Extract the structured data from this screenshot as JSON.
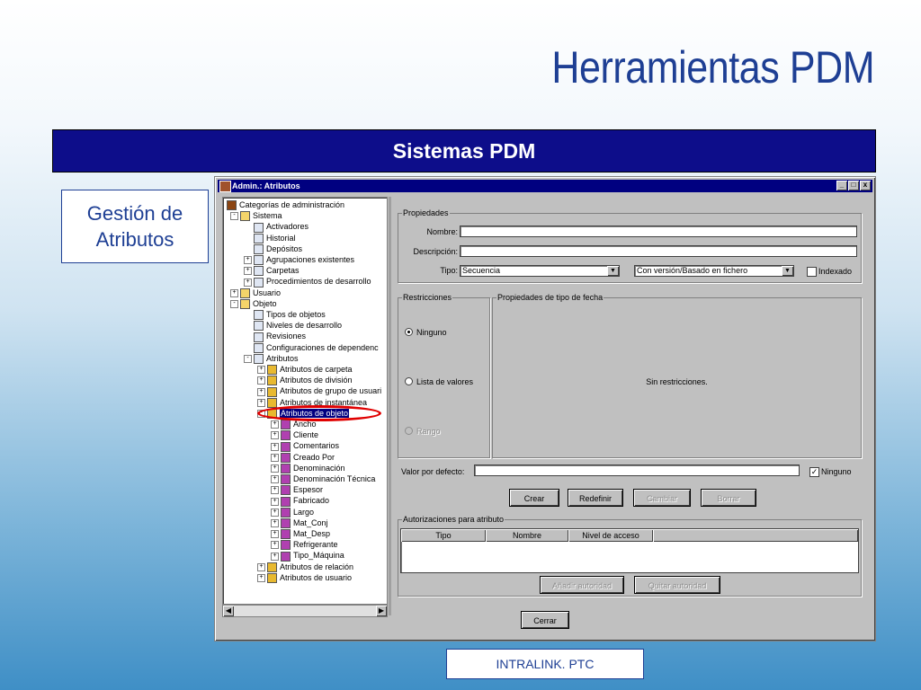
{
  "slide": {
    "title": "Herramientas PDM",
    "banner": "Sistemas PDM",
    "side_label": "Gestión de Atributos",
    "footer": "INTRALINK. PTC"
  },
  "window": {
    "title": "Admin.: Atributos",
    "buttons": [
      "_",
      "□",
      "x"
    ]
  },
  "tree": [
    {
      "label": "Categorías de administración",
      "icon": "root-icon"
    },
    {
      "label": "Sistema",
      "icon": "folder-icon",
      "exp": "-"
    },
    {
      "label": "Activadores",
      "icon": "table-icon"
    },
    {
      "label": "Historial",
      "icon": "table-icon"
    },
    {
      "label": "Depósitos",
      "icon": "table-icon"
    },
    {
      "label": "Agrupaciones existentes",
      "icon": "table-icon",
      "exp": "+"
    },
    {
      "label": "Carpetas",
      "icon": "table-icon",
      "exp": "+"
    },
    {
      "label": "Procedimientos de desarrollo",
      "icon": "table-icon",
      "exp": "+"
    },
    {
      "label": "Usuario",
      "icon": "folder-icon",
      "exp": "+"
    },
    {
      "label": "Objeto",
      "icon": "folder-icon",
      "exp": "-"
    },
    {
      "label": "Tipos de objetos",
      "icon": "table-icon"
    },
    {
      "label": "Niveles de desarrollo",
      "icon": "table-icon"
    },
    {
      "label": "Revisiones",
      "icon": "table-icon"
    },
    {
      "label": "Configuraciones de dependenc",
      "icon": "table-icon"
    },
    {
      "label": "Atributos",
      "icon": "table-icon",
      "exp": "-"
    },
    {
      "label": "Atributos de carpeta",
      "icon": "attr-icon",
      "exp": "+"
    },
    {
      "label": "Atributos de división",
      "icon": "attr-icon",
      "exp": "+"
    },
    {
      "label": "Atributos de grupo de usuari",
      "icon": "attr-icon",
      "exp": "+"
    },
    {
      "label": "Atributos de instantánea",
      "icon": "attr-icon",
      "exp": "+"
    },
    {
      "label": "Atributos de objeto",
      "icon": "attr-icon",
      "exp": "-",
      "selected": true
    },
    {
      "label": "Ancho",
      "icon": "attribute-icon",
      "exp": "+"
    },
    {
      "label": "Cliente",
      "icon": "attribute-icon",
      "exp": "+"
    },
    {
      "label": "Comentarios",
      "icon": "attribute-icon",
      "exp": "+"
    },
    {
      "label": "Creado Por",
      "icon": "attribute-icon",
      "exp": "+"
    },
    {
      "label": "Denominación",
      "icon": "attribute-icon",
      "exp": "+"
    },
    {
      "label": "Denominación Técnica",
      "icon": "attribute-icon",
      "exp": "+"
    },
    {
      "label": "Espesor",
      "icon": "attribute-icon",
      "exp": "+"
    },
    {
      "label": "Fabricado",
      "icon": "attribute-icon",
      "exp": "+"
    },
    {
      "label": "Largo",
      "icon": "attribute-icon",
      "exp": "+"
    },
    {
      "label": "Mat_Conj",
      "icon": "attribute-icon",
      "exp": "+"
    },
    {
      "label": "Mat_Desp",
      "icon": "attribute-icon",
      "exp": "+"
    },
    {
      "label": "Refrigerante",
      "icon": "attribute-icon",
      "exp": "+"
    },
    {
      "label": "Tipo_Máquina",
      "icon": "attribute-icon",
      "exp": "+"
    },
    {
      "label": "Atributos de relación",
      "icon": "attr-icon",
      "exp": "+"
    },
    {
      "label": "Atributos de usuario",
      "icon": "attr-icon",
      "exp": "+"
    }
  ],
  "props": {
    "group_title": "Propiedades",
    "nombre_label": "Nombre:",
    "nombre_value": "",
    "descripcion_label": "Descripción:",
    "descripcion_value": "",
    "tipo_label": "Tipo:",
    "tipo_value": "Secuencia",
    "version_value": "Con versión/Basado en fichero",
    "indexado_label": "Indexado",
    "indexado_checked": false
  },
  "restr": {
    "group_title": "Restricciones",
    "ninguno": "Ninguno",
    "lista": "Lista de valores",
    "rango": "Rango",
    "selected": "Ninguno"
  },
  "tipo_props": {
    "group_title": "Propiedades de tipo de fecha",
    "message": "Sin restricciones."
  },
  "default_value": {
    "label": "Valor por defecto:",
    "value": "",
    "ninguno_label": "Ninguno",
    "ninguno_checked": true
  },
  "actions": {
    "crear": "Crear",
    "redefinir": "Redefinir",
    "cambiar": "Cambiar",
    "borrar": "Borrar"
  },
  "auth": {
    "group_title": "Autorizaciones para atributo",
    "columns": [
      "Tipo",
      "Nombre",
      "Nivel de acceso"
    ],
    "add": "Añadir autoridad",
    "remove": "Quitar autoridad"
  },
  "close_button": "Cerrar"
}
